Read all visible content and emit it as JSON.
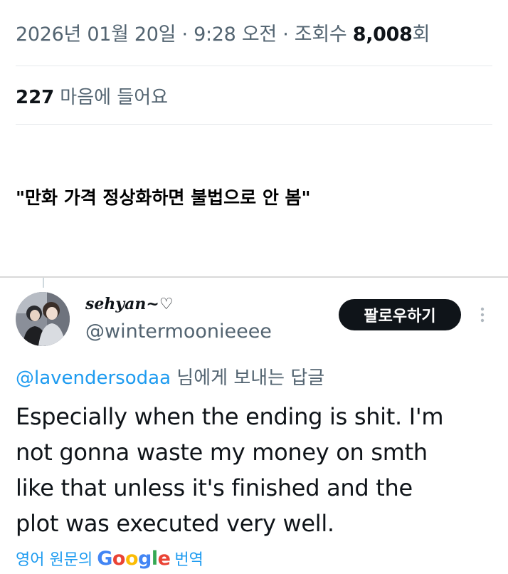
{
  "tweet_meta": {
    "date": "2026년 01월 20일",
    "separator": "·",
    "time": "9:28 오전",
    "views_label": "조회수",
    "views_count": "8,008",
    "views_suffix": "회"
  },
  "likes": {
    "count": "227",
    "label": "마음에 들어요"
  },
  "caption": "\"만화 가격 정상화하면 불법으로 안 봄\"",
  "reply": {
    "display_name": "sehyan~♡",
    "handle": "@wintermoonieeee",
    "follow_label": "팔로우하기",
    "reply_to_handle": "@lavendersodaa",
    "reply_to_suffix": " 님에게 보내는 답글",
    "text": "Especially when the ending is shit. I'm\nnot gonna waste my money on smth\nlike that unless it's finished and the\nplot was executed very well.",
    "translate_prefix": "영어 원문의",
    "translate_brand": "Google",
    "translate_suffix": "번역"
  },
  "colors": {
    "text_primary": "#0f1419",
    "text_secondary": "#536471",
    "accent": "#1d9bf0",
    "follow_bg": "#0f1419"
  },
  "icons": {
    "more": "more-vertical-icon"
  }
}
